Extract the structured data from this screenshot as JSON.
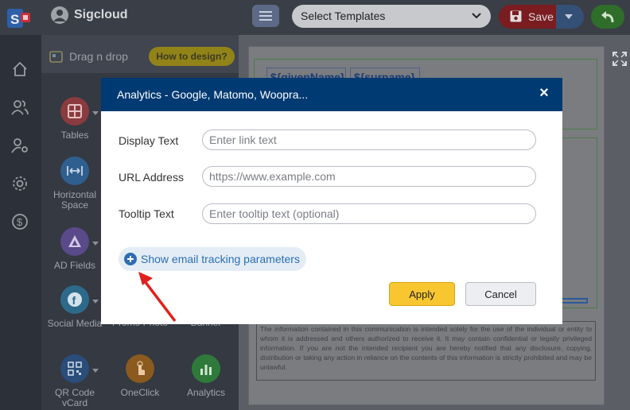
{
  "app": {
    "name": "Sigcloud"
  },
  "toolbar": {
    "template_select": "Select Templates",
    "save_label": "Save"
  },
  "panel": {
    "drag_label": "Drag n drop",
    "how_to": "How to design?",
    "tools": [
      {
        "label": "Tables",
        "icon": "table-icon",
        "color": "#8a3b3f"
      },
      {
        "label": "Horizontal Space",
        "icon": "horizontal-space-icon",
        "color": "#2f5f8e"
      },
      {
        "label": "AD Fields",
        "icon": "ad-fields-icon",
        "color": "#5a4a8a"
      },
      {
        "label": "Social Media",
        "icon": "facebook-icon",
        "color": "#2d6a8a"
      },
      {
        "label": "Promo Photo",
        "icon": "promo-photo-icon"
      },
      {
        "label": "Banner",
        "icon": "banner-icon"
      },
      {
        "label": "QR Code vCard",
        "icon": "qr-code-icon",
        "color": "#2a4d7a"
      },
      {
        "label": "OneClick",
        "icon": "oneclick-icon",
        "color": "#8a5a1e"
      },
      {
        "label": "Analytics",
        "icon": "analytics-icon",
        "color": "#2f7a3a"
      }
    ]
  },
  "canvas": {
    "given_name_placeholder": "${givenName}",
    "surname_placeholder": "${surname}",
    "disclaimer": "The information contained in this communication is intended solely for the use of the individual or entity to whom it is addressed and others authorized to receive it. It may contain confidential or legally privileged information. If you are not the intended recipient you are hereby notified that any disclosure, copying, distribution or taking any action in reliance on the contents of this information is strictly prohibited and may be unlawful."
  },
  "modal": {
    "title": "Analytics - Google, Matomo, Woopra...",
    "close": "×",
    "fields": {
      "display_text": {
        "label": "Display Text",
        "placeholder": "Enter link text",
        "value": ""
      },
      "url_address": {
        "label": "URL Address",
        "placeholder": "https://www.example.com",
        "value": ""
      },
      "tooltip_text": {
        "label": "Tooltip Text",
        "placeholder": "Enter tooltip text (optional)",
        "value": ""
      }
    },
    "tracking_toggle": "Show email tracking parameters",
    "apply": "Apply",
    "cancel": "Cancel"
  },
  "colors": {
    "modal_header": "#003a73",
    "apply_button": "#f8c630",
    "link_blue": "#2a6eb3",
    "arrow_red": "#e0201c"
  }
}
